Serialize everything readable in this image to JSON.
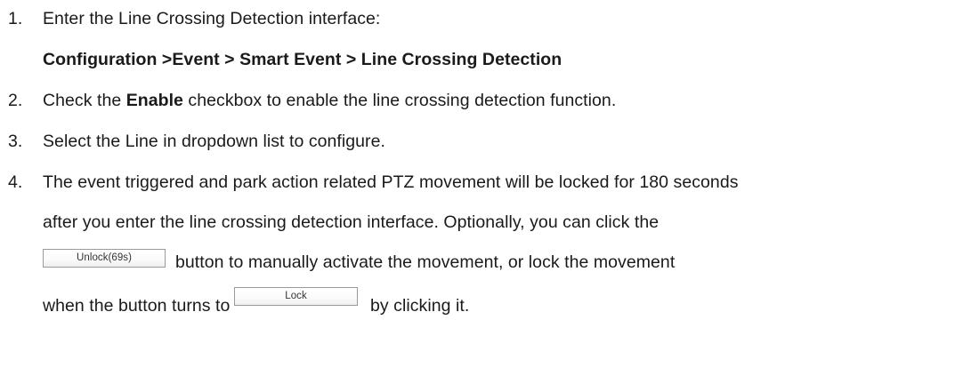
{
  "steps": [
    {
      "number": "1.",
      "text": "Enter the Line Crossing Detection interface:"
    },
    {
      "path": "Configuration >Event > Smart Event > Line Crossing Detection"
    },
    {
      "number": "2.",
      "text_before": "Check the ",
      "bold": "Enable",
      "text_after": " checkbox to enable the line crossing detection function."
    },
    {
      "number": "3.",
      "text": "Select the Line in dropdown list to configure."
    },
    {
      "number": "4.",
      "line1": "The event triggered and park action related PTZ movement will be locked for 180 seconds",
      "line2": "after you enter the line crossing detection interface. Optionally, you can click the",
      "unlock_button": "Unlock(69s)",
      "line3_after": "button to manually activate the movement, or lock the movement",
      "line4_before": "when the button turns to",
      "lock_button": "Lock",
      "line4_after": "by clicking it."
    }
  ]
}
